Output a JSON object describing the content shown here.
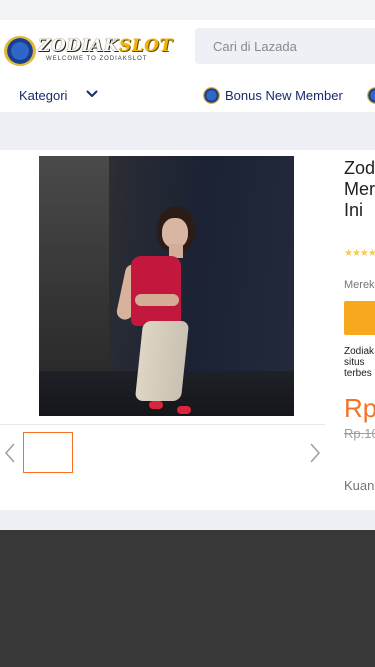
{
  "header": {
    "logo": {
      "text_main": "ZODIAK",
      "text_slot": "SLOT",
      "tagline": "WELCOME TO ZODIAKSLOT"
    },
    "search": {
      "placeholder": "Cari di Lazada"
    }
  },
  "nav": {
    "category_label": "Kategori",
    "bonus_label": "Bonus New Member"
  },
  "product": {
    "title_lines": [
      "Zod",
      "Mer",
      "Ini"
    ],
    "rating_stars": "★★★★",
    "brand_label": "Merek",
    "desc_lines": [
      "Zodiak",
      "situs",
      "terbes"
    ],
    "price": "Rp",
    "old_price": "Rp.10",
    "quantity_label": "Kuan"
  },
  "colors": {
    "accent_orange": "#f57224",
    "button_yellow": "#f7a81d",
    "nav_text": "#1a2a6e",
    "footer_bg": "#383838"
  }
}
